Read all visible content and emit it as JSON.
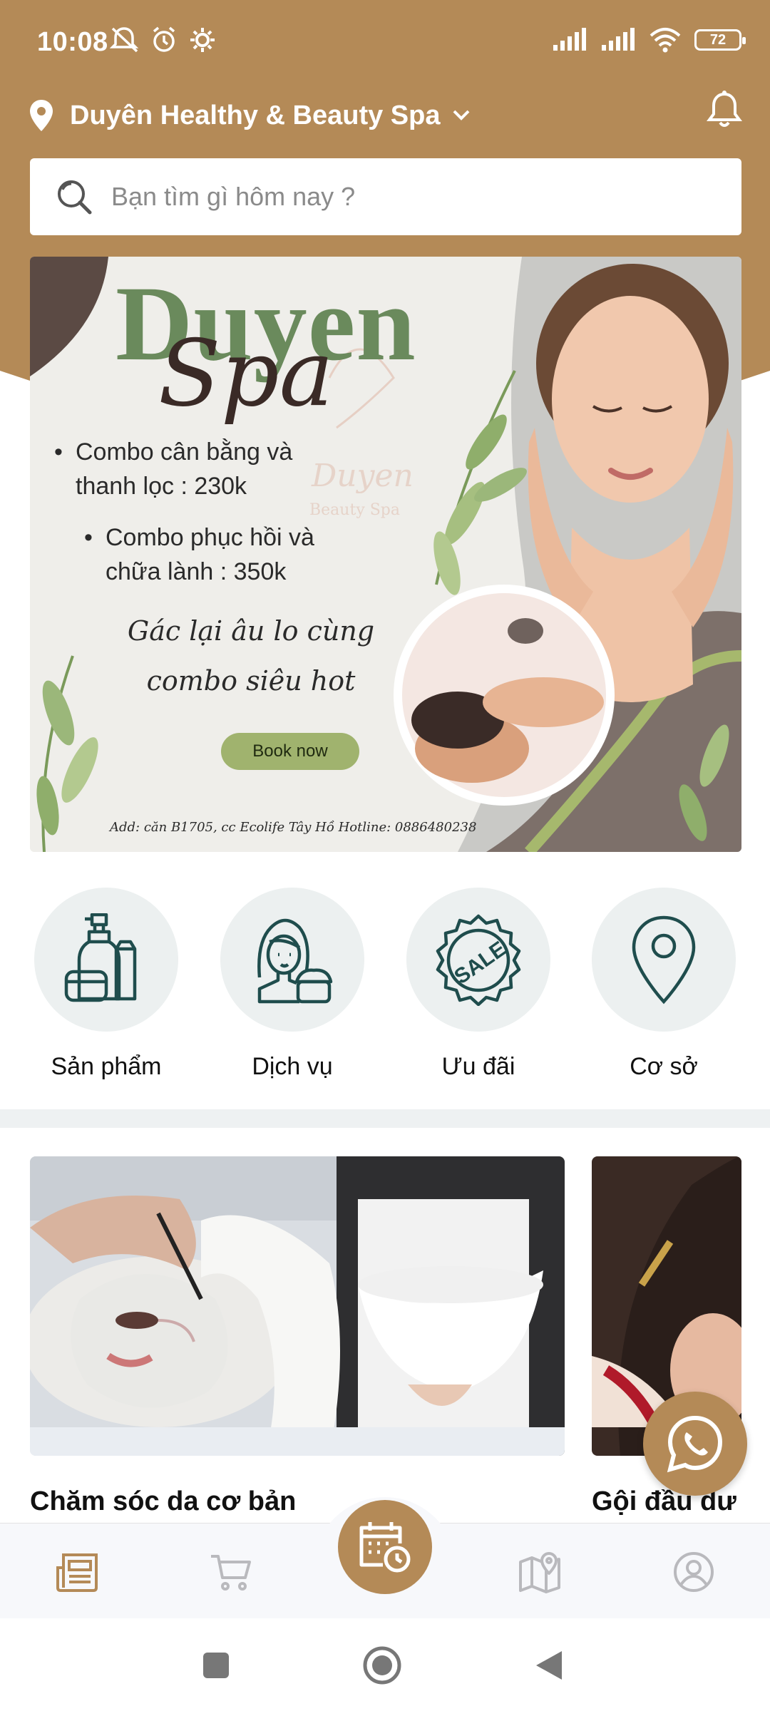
{
  "status_bar": {
    "time": "10:08",
    "battery": "72"
  },
  "header": {
    "location": "Duyên Healthy & Beauty Spa"
  },
  "search": {
    "placeholder": "Bạn tìm gì hôm nay ?"
  },
  "banner": {
    "title": "Duyen",
    "subtitle": "Spa",
    "items": [
      "Combo cân bằng và thanh lọc : 230k",
      "Combo phục hồi và chữa lành : 350k"
    ],
    "tagline": "Gác lại âu lo cùng combo siêu hot",
    "button": "Book now",
    "footer": "Add: căn B1705, cc Ecolife Tây Hồ      Hotline: 0886480238",
    "watermark": [
      "Duyen",
      "Beauty Spa"
    ]
  },
  "categories": [
    {
      "label": "Sản phẩm",
      "icon": "cosmetics-icon"
    },
    {
      "label": "Dịch vụ",
      "icon": "woman-cream-icon"
    },
    {
      "label": "Ưu đãi",
      "icon": "sale-badge-icon"
    },
    {
      "label": "Cơ sở",
      "icon": "location-pin-icon"
    }
  ],
  "services": [
    {
      "title": "Chăm sóc da cơ bản"
    },
    {
      "title": "Gội đầu dư"
    }
  ],
  "bottom_nav": [
    "news-icon",
    "cart-icon",
    "booking-calendar-icon",
    "map-icon",
    "profile-icon"
  ],
  "colors": {
    "brand": "#b48a57",
    "banner_green": "#6a8a5c",
    "icon_teal": "#1f4d4d"
  }
}
